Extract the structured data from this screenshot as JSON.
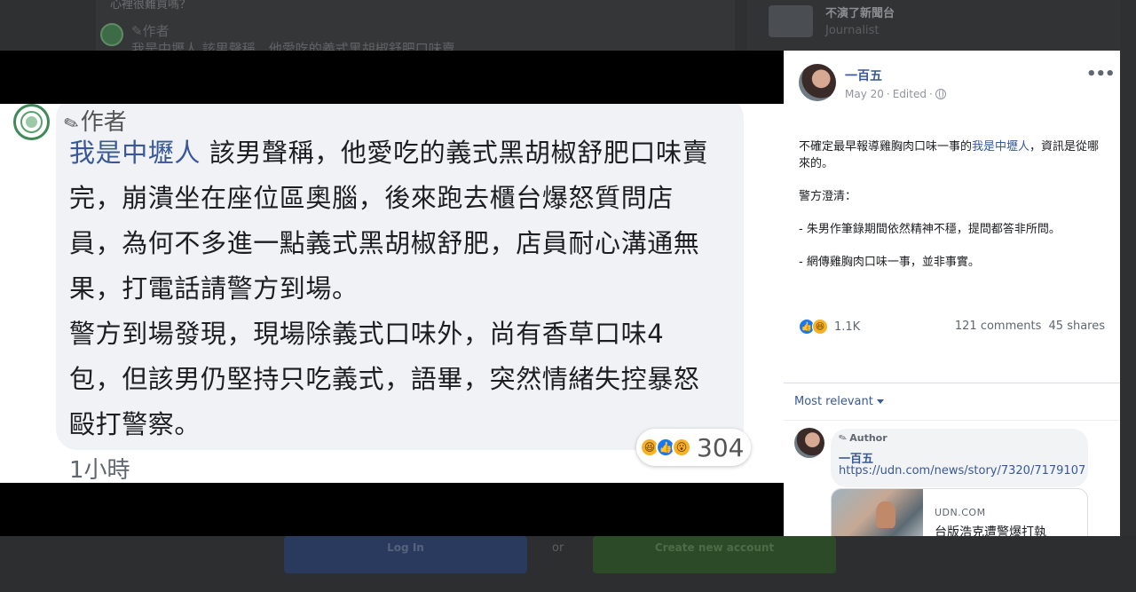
{
  "background": {
    "question_snippet": "心裡很難買嗎？",
    "author_label": "作者",
    "comment_snippet": "我是中壢人 該男聲稱，他愛吃的義式黑胡椒舒肥口味賣",
    "page_name": "不演了新聞台",
    "page_role": "Journalist",
    "login_label": "Log In",
    "or_label": "or",
    "create_account_label": "Create new account"
  },
  "photo": {
    "author_badge": "作者",
    "mention": "我是中壢人",
    "lines": [
      " 該男聲稱，他愛吃的義式黑胡椒舒肥口味賣",
      "完，崩潰坐在座位區奧腦，後來跑去櫃台爆怒質問店",
      "員，為何不多進一點義式黑胡椒舒肥，店員耐心溝通無",
      "果，打電話請警方到場。",
      "警方到場發現，現場除義式口味外，尚有香草口味4",
      "包，但該男仍堅持只吃義式，語畢，突然情緒失控暴怒",
      "毆打警察。"
    ],
    "reaction_count": "304",
    "time": "1小時"
  },
  "post": {
    "author": "一百五",
    "date": "May 20",
    "edited": "Edited",
    "separator": "·",
    "more_label": "•••",
    "text_before_mention": "不確定最早報導雞胸肉口味一事的",
    "mention": "我是中壢人",
    "text_after_mention": "，資訊是從哪來的。",
    "para2": "警方澄清：",
    "para3": "- 朱男作筆錄期間依然精神不穩，提問都答非所問。",
    "para4": "- 網傳雞胸肉口味一事，並非事實。",
    "reaction_count": "1.1K",
    "comments": "121 comments",
    "shares": "45 shares"
  },
  "comments_section": {
    "sort_label": "Most relevant",
    "comment": {
      "badge": "Author",
      "name": "一百五",
      "link": "https://udn.com/news/story/7320/7179107",
      "card_site": "UDN.COM",
      "card_title": "台版浩克遭警爆打執"
    }
  },
  "colors": {
    "link_blue": "#385898",
    "like_blue": "#1877f2",
    "haha_yellow": "#f7b125"
  },
  "icons": [
    "pencil-icon",
    "globe-icon",
    "like-reaction-icon",
    "haha-reaction-icon",
    "wow-reaction-icon",
    "caret-down-icon",
    "more-options-icon"
  ]
}
